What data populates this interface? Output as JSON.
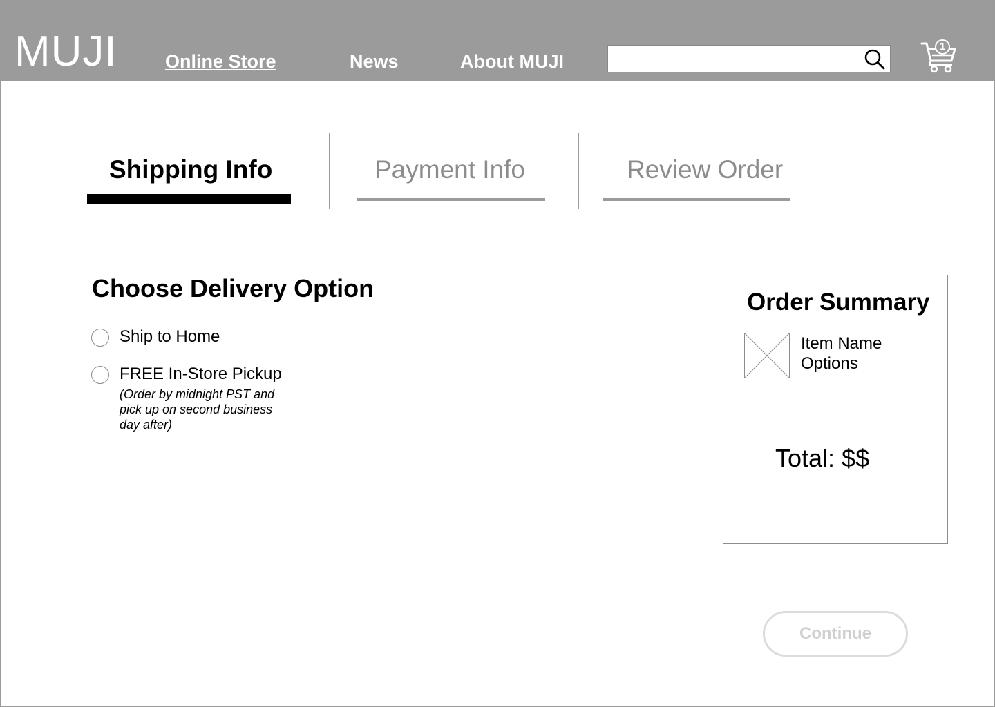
{
  "header": {
    "logo": "MUJI",
    "nav": {
      "online_store": "Online Store",
      "news": "News",
      "about": "About MUJI"
    },
    "search": {
      "value": "",
      "placeholder": "",
      "icon": "search-icon"
    },
    "cart": {
      "icon": "cart-icon",
      "count": "1"
    }
  },
  "steps": {
    "shipping": "Shipping Info",
    "payment": "Payment Info",
    "review": "Review Order",
    "active": "shipping"
  },
  "delivery": {
    "title": "Choose Delivery Option",
    "options": [
      {
        "label": "Ship to Home",
        "selected": false
      },
      {
        "label": "FREE In-Store Pickup",
        "selected": false,
        "note": "(Order by midnight PST and pick up on second business day after)"
      }
    ]
  },
  "summary": {
    "title": "Order Summary",
    "item_name": "Item Name",
    "item_options": "Options",
    "total": "Total: $$"
  },
  "continue_label": "Continue",
  "colors": {
    "header_bg": "#9b9b9b",
    "active_step": "#000000",
    "inactive_step": "#8c8c8c",
    "disabled_button": "#d0d0d0"
  }
}
